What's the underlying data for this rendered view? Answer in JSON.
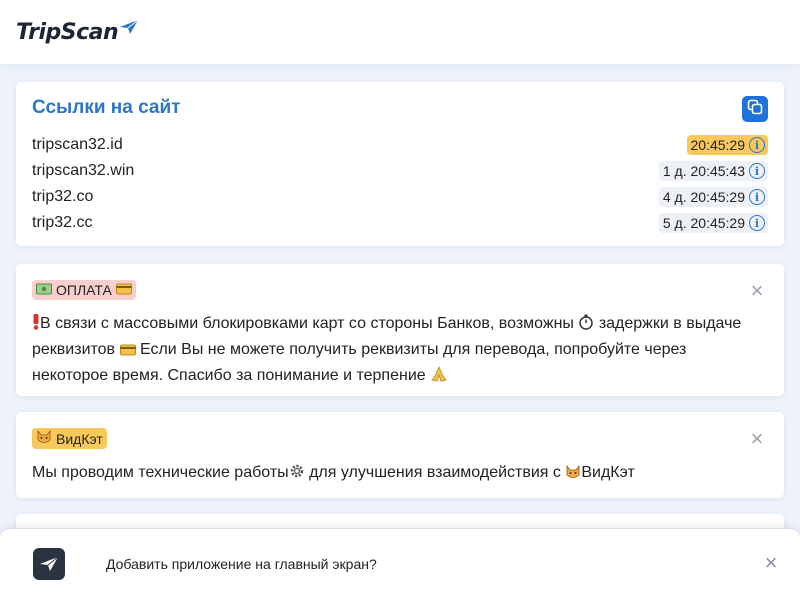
{
  "header": {
    "logo_text": "TripScan",
    "logo_icon": "paper-plane-icon"
  },
  "links_card": {
    "title": "Ссылки на сайт",
    "copy_icon": "copy-icon",
    "items": [
      {
        "url": "tripscan32.id",
        "time": "20:45:29",
        "highlight": true
      },
      {
        "url": "tripscan32.win",
        "time": "1 д. 20:45:43",
        "highlight": false
      },
      {
        "url": "trip32.co",
        "time": "4 д. 20:45:29",
        "highlight": false
      },
      {
        "url": "trip32.cc",
        "time": "5 д. 20:45:29",
        "highlight": false
      }
    ]
  },
  "notices": {
    "payment": {
      "tag": "ОПЛАТА",
      "text_1": "В связи с массовыми блокировками карт со стороны Банков, возможны",
      "text_2": "задержки в выдаче реквизитов",
      "text_3": "Если Вы не можете получить реквизиты для перевода, попробуйте через некоторое время. Спасибо за понимание и терпение"
    },
    "vidkat": {
      "tag": "ВидКэт",
      "text_1": "Мы проводим технические работы",
      "text_2": "для улучшения взаимодействия с",
      "text_3": "ВидКэт"
    }
  },
  "install_banner": {
    "text": "Добавить приложение на главный экран?"
  },
  "colors": {
    "accent": "#2d76c2",
    "button": "#1f73d8",
    "highlight": "#f7c85a",
    "payment_tag": "#f8cfcc"
  }
}
